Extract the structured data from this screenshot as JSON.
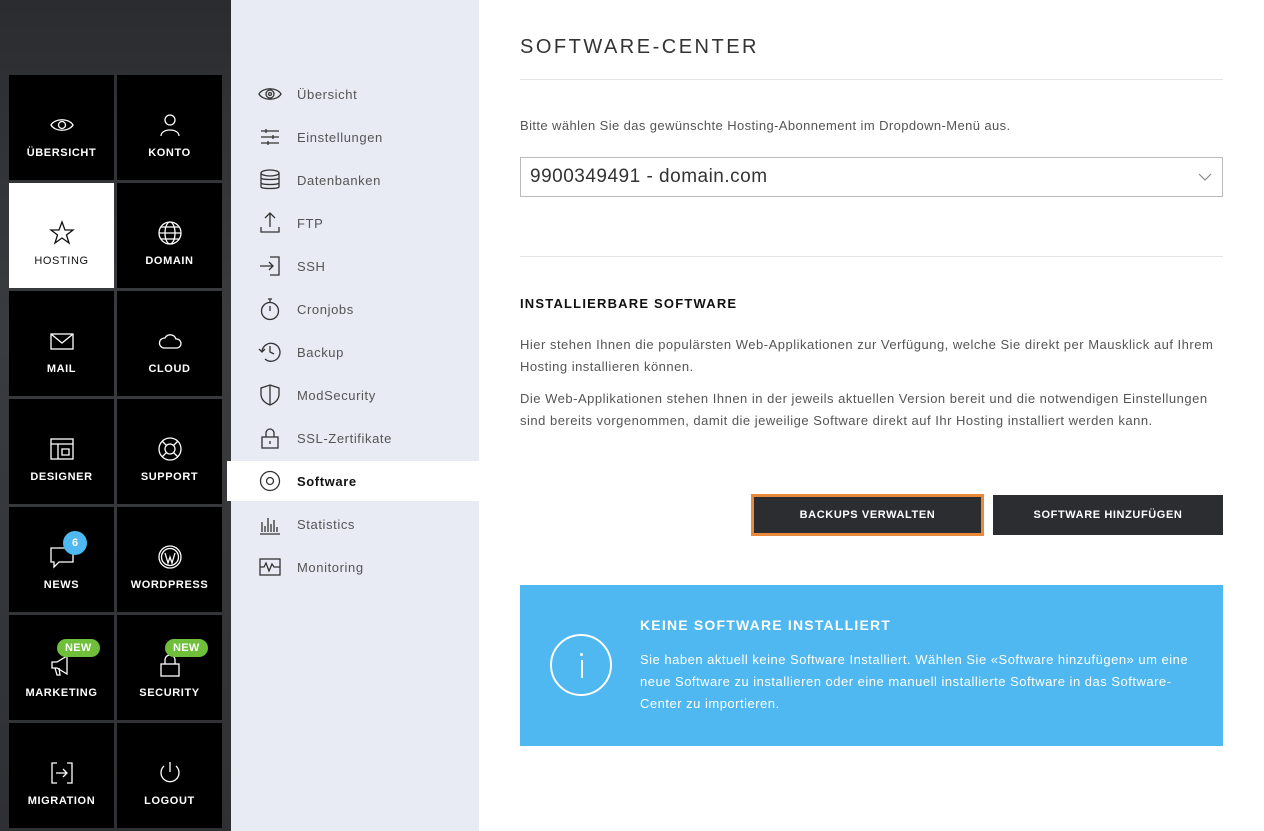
{
  "tiles": [
    {
      "label": "ÜBERSICHT",
      "icon": "eye-icon",
      "active": false
    },
    {
      "label": "KONTO",
      "icon": "user-icon",
      "active": false
    },
    {
      "label": "HOSTING",
      "icon": "star-icon",
      "active": true
    },
    {
      "label": "DOMAIN",
      "icon": "globe-icon",
      "active": false
    },
    {
      "label": "MAIL",
      "icon": "envelope-icon",
      "active": false
    },
    {
      "label": "CLOUD",
      "icon": "cloud-icon",
      "active": false
    },
    {
      "label": "DESIGNER",
      "icon": "layout-icon",
      "active": false
    },
    {
      "label": "SUPPORT",
      "icon": "lifebuoy-icon",
      "active": false
    },
    {
      "label": "NEWS",
      "icon": "chat-icon",
      "active": false,
      "badge": "6"
    },
    {
      "label": "WORDPRESS",
      "icon": "wordpress-icon",
      "active": false
    },
    {
      "label": "MARKETING",
      "icon": "megaphone-icon",
      "active": false,
      "badge_new": "NEW"
    },
    {
      "label": "SECURITY",
      "icon": "lock-icon",
      "active": false,
      "badge_new": "NEW"
    },
    {
      "label": "MIGRATION",
      "icon": "migration-icon",
      "active": false
    },
    {
      "label": "LOGOUT",
      "icon": "power-icon",
      "active": false
    }
  ],
  "submenu": [
    {
      "label": "Übersicht",
      "icon": "eye-icon"
    },
    {
      "label": "Einstellungen",
      "icon": "sliders-icon"
    },
    {
      "label": "Datenbanken",
      "icon": "database-icon"
    },
    {
      "label": "FTP",
      "icon": "upload-icon"
    },
    {
      "label": "SSH",
      "icon": "login-icon"
    },
    {
      "label": "Cronjobs",
      "icon": "stopwatch-icon"
    },
    {
      "label": "Backup",
      "icon": "history-icon"
    },
    {
      "label": "ModSecurity",
      "icon": "shield-icon"
    },
    {
      "label": "SSL-Zertifikate",
      "icon": "certificate-lock-icon"
    },
    {
      "label": "Software",
      "icon": "disc-icon",
      "active": true
    },
    {
      "label": "Statistics",
      "icon": "bar-chart-icon"
    },
    {
      "label": "Monitoring",
      "icon": "pulse-icon"
    }
  ],
  "main": {
    "title": "SOFTWARE-CENTER",
    "intro": "Bitte wählen Sie das gewünschte Hosting-Abonnement im Dropdown-Menü aus.",
    "select_value": "9900349491 - domain.com",
    "section_title": "INSTALLIERBARE SOFTWARE",
    "para1": "Hier stehen Ihnen die populärsten Web-Applikationen zur Verfügung, welche Sie direkt per Mausklick auf Ihrem Hosting installieren können.",
    "para2": "Die Web-Applikationen stehen Ihnen in der jeweils aktuellen Version bereit und die notwendigen Einstellungen sind bereits vorgenommen, damit die jeweilige Software direkt auf Ihr Hosting installiert werden kann.",
    "btn_backup": "BACKUPS VERWALTEN",
    "btn_add": "SOFTWARE HINZUFÜGEN",
    "info_title": "KEINE SOFTWARE INSTALLIERT",
    "info_text": "Sie haben aktuell keine Software Installiert. Wählen Sie «Software hinzufügen» um eine neue Software zu installieren oder eine manuell installierte Software in das Software-Center zu importieren."
  },
  "colors": {
    "accent_blue": "#4fb8f0",
    "new_green": "#6fbf3a",
    "focus_orange": "#e88a3a",
    "button_dark": "#2b2d31"
  }
}
